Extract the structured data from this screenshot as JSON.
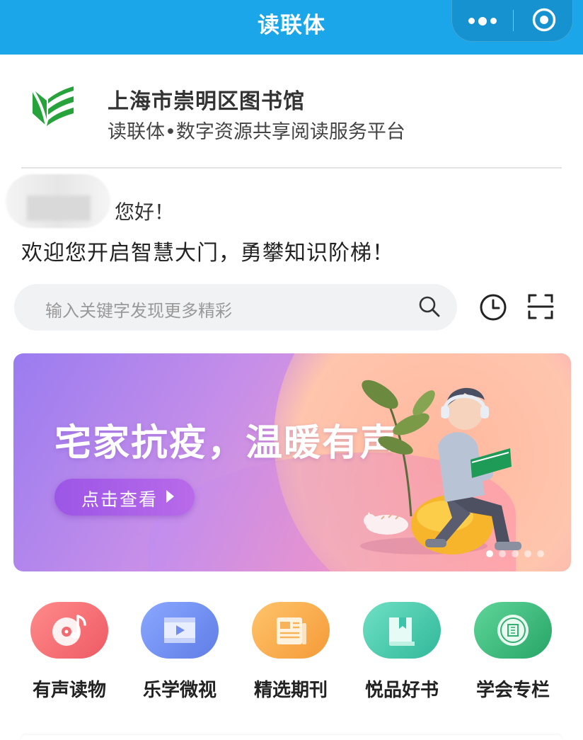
{
  "topbar": {
    "title": "读联体",
    "capsule_more_icon": "more-dots-icon",
    "capsule_close_icon": "target-circle-icon",
    "background": "#1aa6e8"
  },
  "library": {
    "name": "上海市崇明区图书馆",
    "subtitle": "读联体•数字资源共享阅读服务平台",
    "logo_icon": "book-leaf-logo",
    "logo_color": "#27a33c"
  },
  "greeting": {
    "hello": "您好！",
    "welcome": "欢迎您开启智慧大门，勇攀知识阶梯！"
  },
  "search": {
    "placeholder": "输入关键字发现更多精彩",
    "search_icon": "search-icon",
    "history_icon": "clock-icon",
    "scan_icon": "scan-icon"
  },
  "banner": {
    "headline": "宅家抗疫，温暖有声",
    "cta_label": "点击查看",
    "slide_count": 5,
    "active_slide": 1
  },
  "categories": [
    {
      "label": "有声读物",
      "icon": "music-disc-icon",
      "color": "#f26d6d"
    },
    {
      "label": "乐学微视",
      "icon": "video-icon",
      "color": "#6b8df0"
    },
    {
      "label": "精选期刊",
      "icon": "newspaper-icon",
      "color": "#f7a94a"
    },
    {
      "label": "悦品好书",
      "icon": "book-icon",
      "color": "#3cc4a8"
    },
    {
      "label": "学会专栏",
      "icon": "seal-icon",
      "color": "#33b072"
    }
  ]
}
